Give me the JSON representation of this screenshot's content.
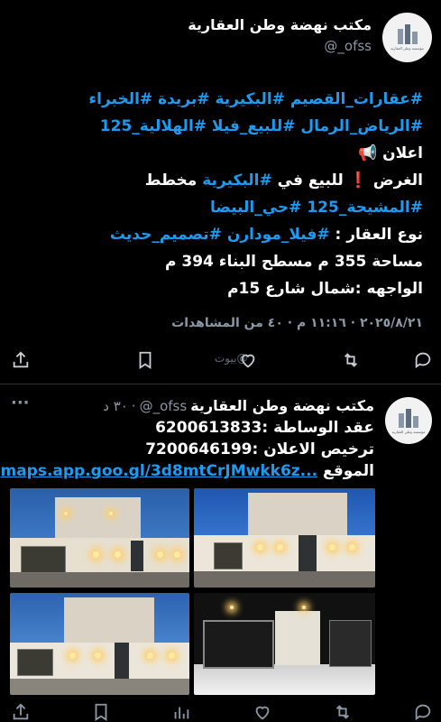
{
  "tweet": {
    "avatar_caption": "مؤسسة وطن العقارية",
    "display_name": "مكتب نهضة وطن العقارية",
    "handle": "@_ofss",
    "lines": [
      [
        {
          "t": "#عقارات_القصيم #البكيرية #بريدة #الخبراء",
          "tag": true
        }
      ],
      [
        {
          "t": "#الرياض_الرمال #للبيع_فيلا #الهلالية_125",
          "tag": true
        }
      ],
      [
        {
          "t": "اعلان 📢",
          "tag": false
        }
      ],
      [
        {
          "t": "الغرض ❗ للبيع في ",
          "tag": false
        },
        {
          "t": "#البكيرية",
          "tag": true
        },
        {
          "t": " مخطط",
          "tag": false
        }
      ],
      [
        {
          "t": "#المشيحة_125 #حي_البيضا",
          "tag": true
        }
      ],
      [
        {
          "t": "نوع العقار : ",
          "tag": false
        },
        {
          "t": "#فيلا_مودارن",
          "tag": true
        },
        {
          "t": "  ",
          "tag": false
        },
        {
          "t": "#تصميم_حديث",
          "tag": true
        }
      ],
      [
        {
          "t": "مساحة 355 م مسطح البناء 394 م",
          "tag": false
        }
      ],
      [
        {
          "t": "الواجهه :شمال شارع 15م",
          "tag": false
        }
      ]
    ],
    "meta": "٢٠٢٥/٨/٢١ · ١١:١٦ م · ٤٠ من المشاهدات",
    "watermark": "بيوت@"
  },
  "reply": {
    "display_name": "مكتب نهضة وطن العقارية",
    "handle": "@_ofss",
    "time": "٣٠ د",
    "more": "···",
    "lines": [
      {
        "t": "عقد الوساطة :6200613833",
        "link": false
      },
      {
        "t": "ترخيص الاعلان :7200646199",
        "link": false
      }
    ],
    "location_label": "الموقع",
    "location_link": "maps.app.goo.gl/3d8mtCrJMwkk6z..."
  },
  "colors": {
    "background": "#000000",
    "accent": "#1d9bf0",
    "muted": "#8b98a5",
    "separator": "#2f3336"
  },
  "icons": [
    "reply-icon",
    "retweet-icon",
    "like-icon",
    "bookmark-icon",
    "share-icon",
    "views-icon",
    "more-icon"
  ]
}
